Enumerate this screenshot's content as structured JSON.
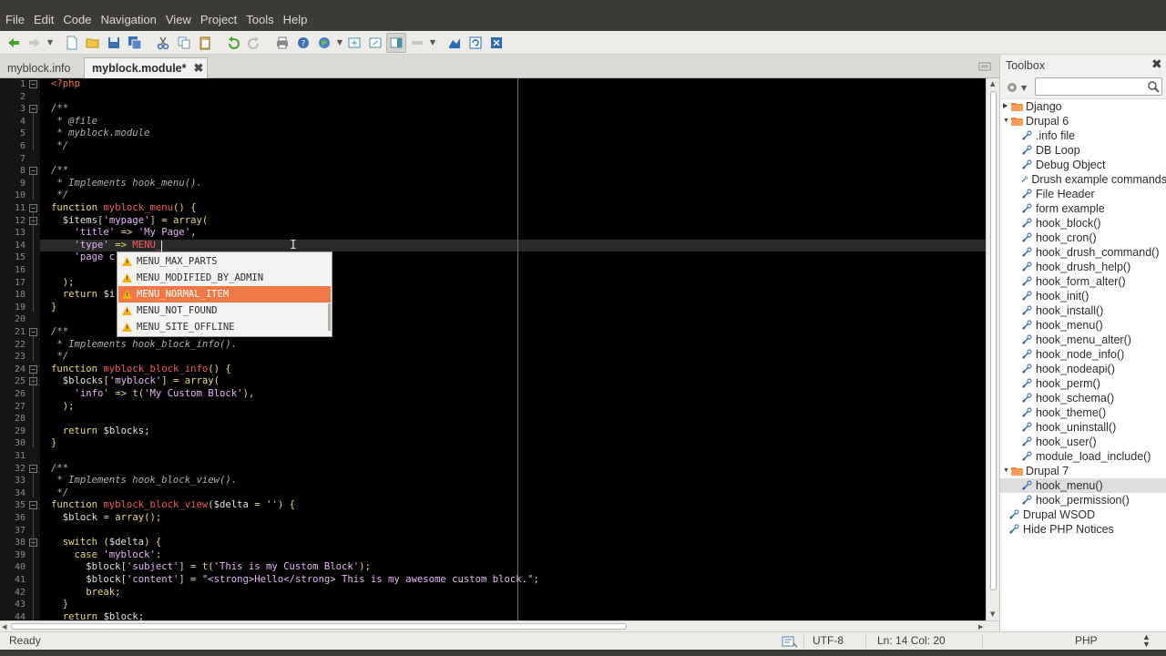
{
  "menubar": {
    "items": [
      "File",
      "Edit",
      "Code",
      "Navigation",
      "View",
      "Project",
      "Tools",
      "Help"
    ]
  },
  "tabs": [
    {
      "label": "myblock.info",
      "active": false
    },
    {
      "label": "myblock.module*",
      "active": true
    }
  ],
  "editor": {
    "current_line": 14,
    "lines": [
      {
        "n": "1",
        "html": "<span class='php'>&lt;?php</span>"
      },
      {
        "n": "2",
        "html": ""
      },
      {
        "n": "3",
        "html": "<span class='cm'>/**</span>"
      },
      {
        "n": "4",
        "html": "<span class='cm'> * @file</span>"
      },
      {
        "n": "5",
        "html": "<span class='cm'> * myblock.module</span>"
      },
      {
        "n": "6",
        "html": "<span class='cm'> */</span>"
      },
      {
        "n": "7",
        "html": ""
      },
      {
        "n": "8",
        "html": "<span class='cm'>/**</span>"
      },
      {
        "n": "9",
        "html": "<span class='cm'> * Implements hook_menu().</span>"
      },
      {
        "n": "10",
        "html": "<span class='cm'> */</span>"
      },
      {
        "n": "11",
        "html": "<span class='kw'>function</span> <span class='fn'>myblock_menu</span><span class='kw'>() {</span>"
      },
      {
        "n": "12",
        "html": "  <span class='var'>$items</span><span class='kw'>[</span><span class='str'>'mypage'</span><span class='kw'>] = array(</span>"
      },
      {
        "n": "13",
        "html": "    <span class='str'>'title'</span> <span class='kw'>=&gt;</span> <span class='str'>'My Page'</span><span class='kw'>,</span>"
      },
      {
        "n": "14",
        "html": "    <span class='str'>'type'</span> <span class='kw'>=&gt;</span> <span class='fn'>MENU_</span>"
      },
      {
        "n": "15",
        "html": "    <span class='str'>'page c</span>"
      },
      {
        "n": "16",
        "html": ""
      },
      {
        "n": "17",
        "html": "  <span class='kw'>);</span>"
      },
      {
        "n": "18",
        "html": "  <span class='kw'>return</span> <span class='var'>$i</span>"
      },
      {
        "n": "19",
        "html": "<span class='kw'>}</span>"
      },
      {
        "n": "20",
        "html": ""
      },
      {
        "n": "21",
        "html": "<span class='cm'>/**</span>"
      },
      {
        "n": "22",
        "html": "<span class='cm'> * Implements hook_block_info().</span>"
      },
      {
        "n": "23",
        "html": "<span class='cm'> */</span>"
      },
      {
        "n": "24",
        "html": "<span class='kw'>function</span> <span class='fn'>myblock_block_info</span><span class='kw'>() {</span>"
      },
      {
        "n": "25",
        "html": "  <span class='var'>$blocks</span><span class='kw'>[</span><span class='str'>'myblock'</span><span class='kw'>] = array(</span>"
      },
      {
        "n": "26",
        "html": "    <span class='str'>'info'</span> <span class='kw'>=&gt; t(</span><span class='str'>'My Custom Block'</span><span class='kw'>),</span>"
      },
      {
        "n": "27",
        "html": "  <span class='kw'>);</span>"
      },
      {
        "n": "28",
        "html": ""
      },
      {
        "n": "29",
        "html": "  <span class='kw'>return</span> <span class='var'>$blocks;</span>"
      },
      {
        "n": "30",
        "html": "<span class='kw'>}</span>"
      },
      {
        "n": "31",
        "html": ""
      },
      {
        "n": "32",
        "html": "<span class='cm'>/**</span>"
      },
      {
        "n": "33",
        "html": "<span class='cm'> * Implements hook_block_view().</span>"
      },
      {
        "n": "34",
        "html": "<span class='cm'> */</span>"
      },
      {
        "n": "35",
        "html": "<span class='kw'>function</span> <span class='fn'>myblock_block_view</span><span class='kw'>(</span><span class='var'>$delta</span> <span class='kw'>=</span> <span class='str'>''</span><span class='kw'>) {</span>"
      },
      {
        "n": "36",
        "html": "  <span class='var'>$block</span> <span class='kw'>= array();</span>"
      },
      {
        "n": "37",
        "html": ""
      },
      {
        "n": "38",
        "html": "  <span class='kw'>switch (</span><span class='var'>$delta</span><span class='kw'>) {</span>"
      },
      {
        "n": "39",
        "html": "    <span class='kw'>case</span> <span class='str'>'myblock'</span><span class='kw'>:</span>"
      },
      {
        "n": "40",
        "html": "      <span class='var'>$block</span><span class='kw'>[</span><span class='str'>'subject'</span><span class='kw'>] = t(</span><span class='str'>'This is my Custom Block'</span><span class='kw'>);</span>"
      },
      {
        "n": "41",
        "html": "      <span class='var'>$block</span><span class='kw'>[</span><span class='str'>'content'</span><span class='kw'>] =</span> <span class='str'>\"&lt;strong&gt;Hello&lt;/strong&gt; This is my awesome custom block.\"</span><span class='kw'>;</span>"
      },
      {
        "n": "42",
        "html": "      <span class='kw'>break;</span>"
      },
      {
        "n": "43",
        "html": "  <span class='kw'>}</span>"
      },
      {
        "n": "44",
        "html": "  <span class='kw'>return</span> <span class='var'>$block;</span>"
      }
    ],
    "fold_markers": [
      {
        "line": 1,
        "glyph": "−"
      },
      {
        "line": 3,
        "glyph": "−"
      },
      {
        "line": 8,
        "glyph": "−"
      },
      {
        "line": 11,
        "glyph": "−"
      },
      {
        "line": 12,
        "glyph": "−"
      },
      {
        "line": 21,
        "glyph": "−"
      },
      {
        "line": 24,
        "glyph": "−"
      },
      {
        "line": 25,
        "glyph": "−"
      },
      {
        "line": 32,
        "glyph": "−"
      },
      {
        "line": 35,
        "glyph": "−"
      },
      {
        "line": 38,
        "glyph": "−"
      }
    ]
  },
  "autocomplete": {
    "items": [
      "MENU_MAX_PARTS",
      "MENU_MODIFIED_BY_ADMIN",
      "MENU_NORMAL_ITEM",
      "MENU_NOT_FOUND",
      "MENU_SITE_OFFLINE"
    ],
    "selected_index": 2
  },
  "toolbox": {
    "title": "Toolbox",
    "search_placeholder": "",
    "tree": [
      {
        "label": "Django",
        "kind": "folder",
        "expanded": false
      },
      {
        "label": "Drupal 6",
        "kind": "folder",
        "expanded": true
      },
      {
        "label": ".info file",
        "kind": "snippet"
      },
      {
        "label": "DB Loop",
        "kind": "snippet"
      },
      {
        "label": "Debug Object",
        "kind": "snippet"
      },
      {
        "label": "Drush example commands",
        "kind": "snippet"
      },
      {
        "label": "File Header",
        "kind": "snippet"
      },
      {
        "label": "form example",
        "kind": "snippet"
      },
      {
        "label": "hook_block()",
        "kind": "snippet"
      },
      {
        "label": "hook_cron()",
        "kind": "snippet"
      },
      {
        "label": "hook_drush_command()",
        "kind": "snippet"
      },
      {
        "label": "hook_drush_help()",
        "kind": "snippet"
      },
      {
        "label": "hook_form_alter()",
        "kind": "snippet"
      },
      {
        "label": "hook_init()",
        "kind": "snippet"
      },
      {
        "label": "hook_install()",
        "kind": "snippet"
      },
      {
        "label": "hook_menu()",
        "kind": "snippet"
      },
      {
        "label": "hook_menu_alter()",
        "kind": "snippet"
      },
      {
        "label": "hook_node_info()",
        "kind": "snippet"
      },
      {
        "label": "hook_nodeapi()",
        "kind": "snippet"
      },
      {
        "label": "hook_perm()",
        "kind": "snippet"
      },
      {
        "label": "hook_schema()",
        "kind": "snippet"
      },
      {
        "label": "hook_theme()",
        "kind": "snippet"
      },
      {
        "label": "hook_uninstall()",
        "kind": "snippet"
      },
      {
        "label": "hook_user()",
        "kind": "snippet"
      },
      {
        "label": "module_load_include()",
        "kind": "snippet"
      },
      {
        "label": "Drupal 7",
        "kind": "folder",
        "expanded": true
      },
      {
        "label": "hook_menu()",
        "kind": "snippet",
        "selected": true
      },
      {
        "label": "hook_permission()",
        "kind": "snippet"
      },
      {
        "label": "Drupal WSOD",
        "kind": "top-snippet"
      },
      {
        "label": "Hide PHP Notices",
        "kind": "top-snippet"
      }
    ]
  },
  "statusbar": {
    "status": "Ready",
    "encoding": "UTF-8",
    "position": "Ln: 14 Col: 20",
    "language": "PHP"
  },
  "colors": {
    "accent": "#f07746",
    "editor_bg": "#000000",
    "chrome_dark": "#3c3b37"
  }
}
